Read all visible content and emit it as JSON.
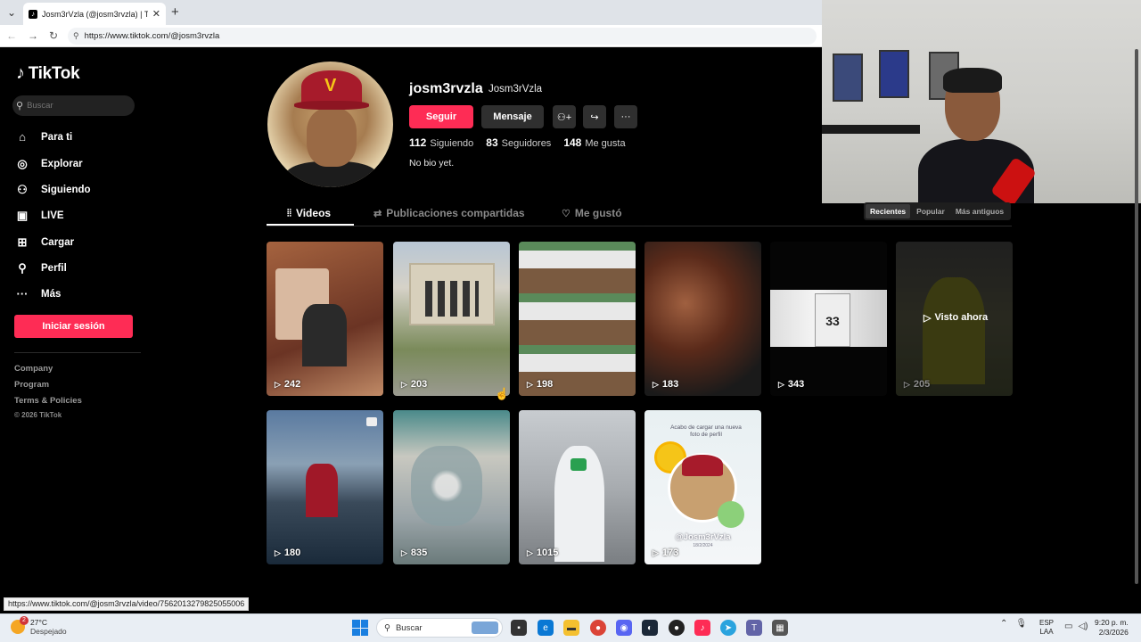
{
  "browser": {
    "tab_title": "Josm3rVzla (@josm3rvzla) | TikTok",
    "url": "https://www.tiktok.com/@josm3rvzla",
    "status_link": "https://www.tiktok.com/@josm3rvzla/video/7562013279825055006"
  },
  "sidebar": {
    "logo_text": "TikTok",
    "search_placeholder": "Buscar",
    "items": [
      {
        "label": "Para ti",
        "icon": "home-icon"
      },
      {
        "label": "Explorar",
        "icon": "compass-icon"
      },
      {
        "label": "Siguiendo",
        "icon": "following-icon"
      },
      {
        "label": "LIVE",
        "icon": "live-icon"
      },
      {
        "label": "Cargar",
        "icon": "upload-icon"
      },
      {
        "label": "Perfil",
        "icon": "profile-icon"
      },
      {
        "label": "Más",
        "icon": "more-icon"
      }
    ],
    "login_label": "Iniciar sesión",
    "footer": [
      "Company",
      "Program",
      "Terms & Policies"
    ],
    "copyright": "© 2026 TikTok"
  },
  "profile": {
    "username": "josm3rvzla",
    "nickname": "Josm3rVzla",
    "follow_label": "Seguir",
    "message_label": "Mensaje",
    "following_count": "112",
    "following_label": "Siguiendo",
    "followers_count": "83",
    "followers_label": "Seguidores",
    "likes_count": "148",
    "likes_label": "Me gusta",
    "bio": "No bio yet."
  },
  "tabs": [
    {
      "label": "Videos",
      "active": true
    },
    {
      "label": "Publicaciones compartidas",
      "active": false
    },
    {
      "label": "Me gustó",
      "active": false
    }
  ],
  "sort": {
    "options": [
      "Recientes",
      "Popular",
      "Más antiguos"
    ],
    "selected": "Recientes"
  },
  "videos": [
    {
      "views": "242"
    },
    {
      "views": "203"
    },
    {
      "views": "198"
    },
    {
      "views": "183"
    },
    {
      "views": "343"
    },
    {
      "views": "205",
      "overlay": "Visto ahora"
    },
    {
      "views": "180"
    },
    {
      "views": "835"
    },
    {
      "views": "1015"
    },
    {
      "views": "173",
      "caption": "Acabo de cargar una nueva foto de perfil",
      "handle": "@Josm3rVzla",
      "date": "18/2/2024"
    }
  ],
  "taskbar": {
    "temperature": "27°C",
    "weather": "Despejado",
    "weather_badge": "2",
    "search_label": "Buscar",
    "lang_1": "ESP",
    "lang_2": "LAA",
    "time": "9:20 p. m.",
    "date": "2/3/2026"
  },
  "colors": {
    "accent": "#fe2c55",
    "background": "#000000"
  }
}
